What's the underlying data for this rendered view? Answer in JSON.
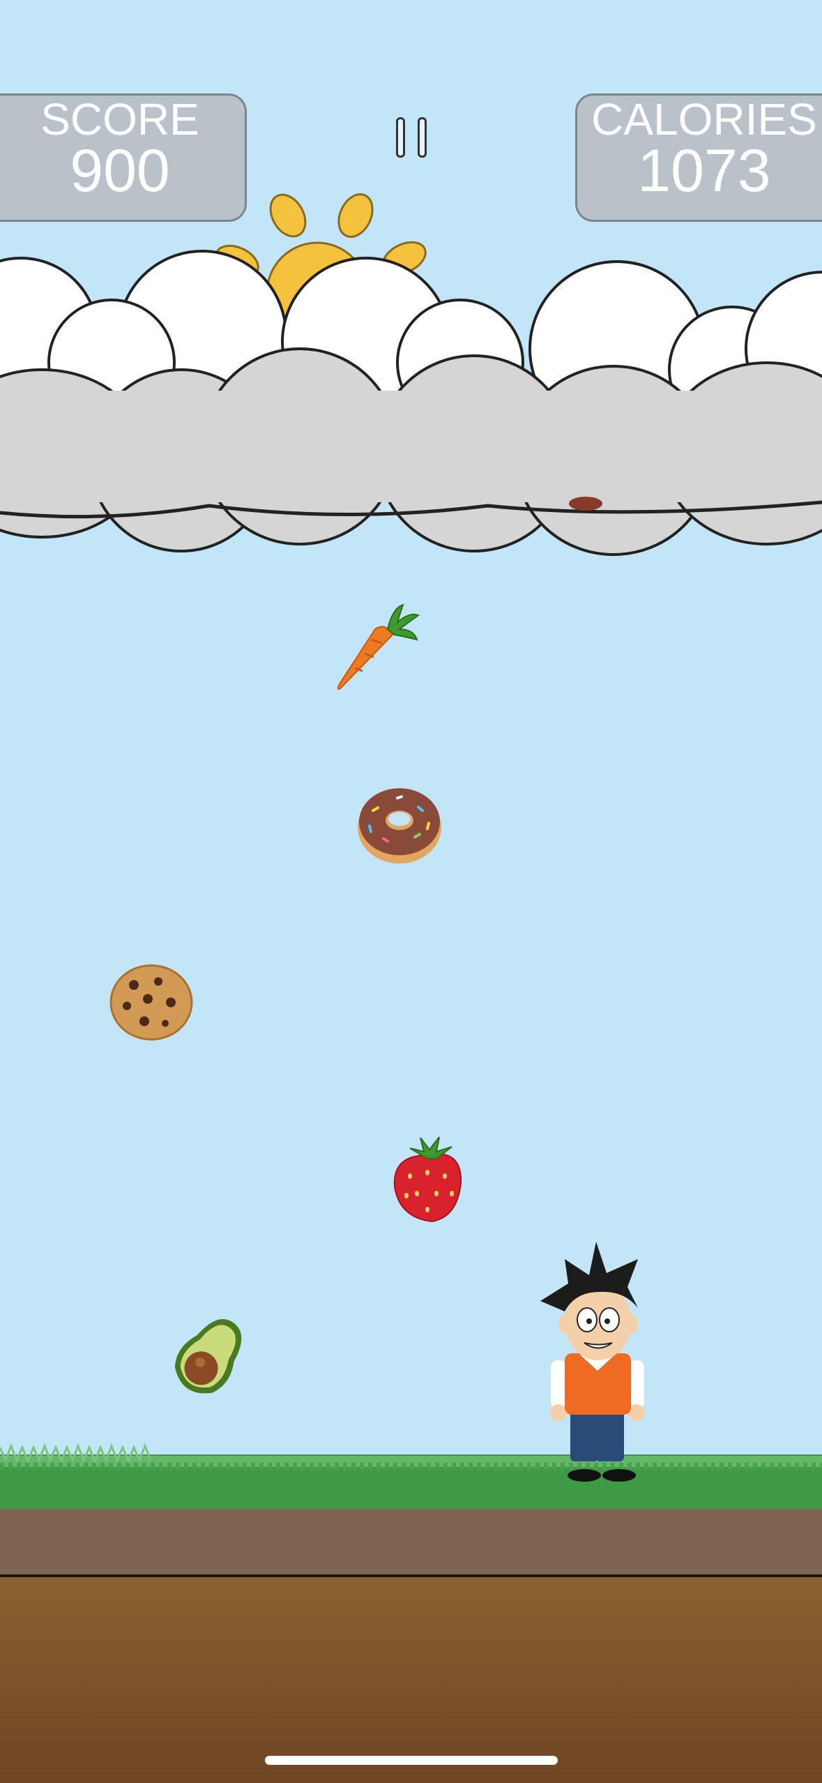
{
  "hud": {
    "score_label": "SCORE",
    "score_value": "900",
    "calories_label": "CALORIES",
    "calories_value": "1073"
  },
  "colors": {
    "sky": "#c2e6f7",
    "grass": "#3f9a46",
    "dirt": "#7a5028",
    "sun": "#f4c23c",
    "cloud_back": "#ffffff",
    "cloud_front": "#d5d5d5"
  },
  "falling_items": [
    "carrot",
    "donut",
    "cookie",
    "strawberry",
    "avocado"
  ],
  "player": "boy-character"
}
